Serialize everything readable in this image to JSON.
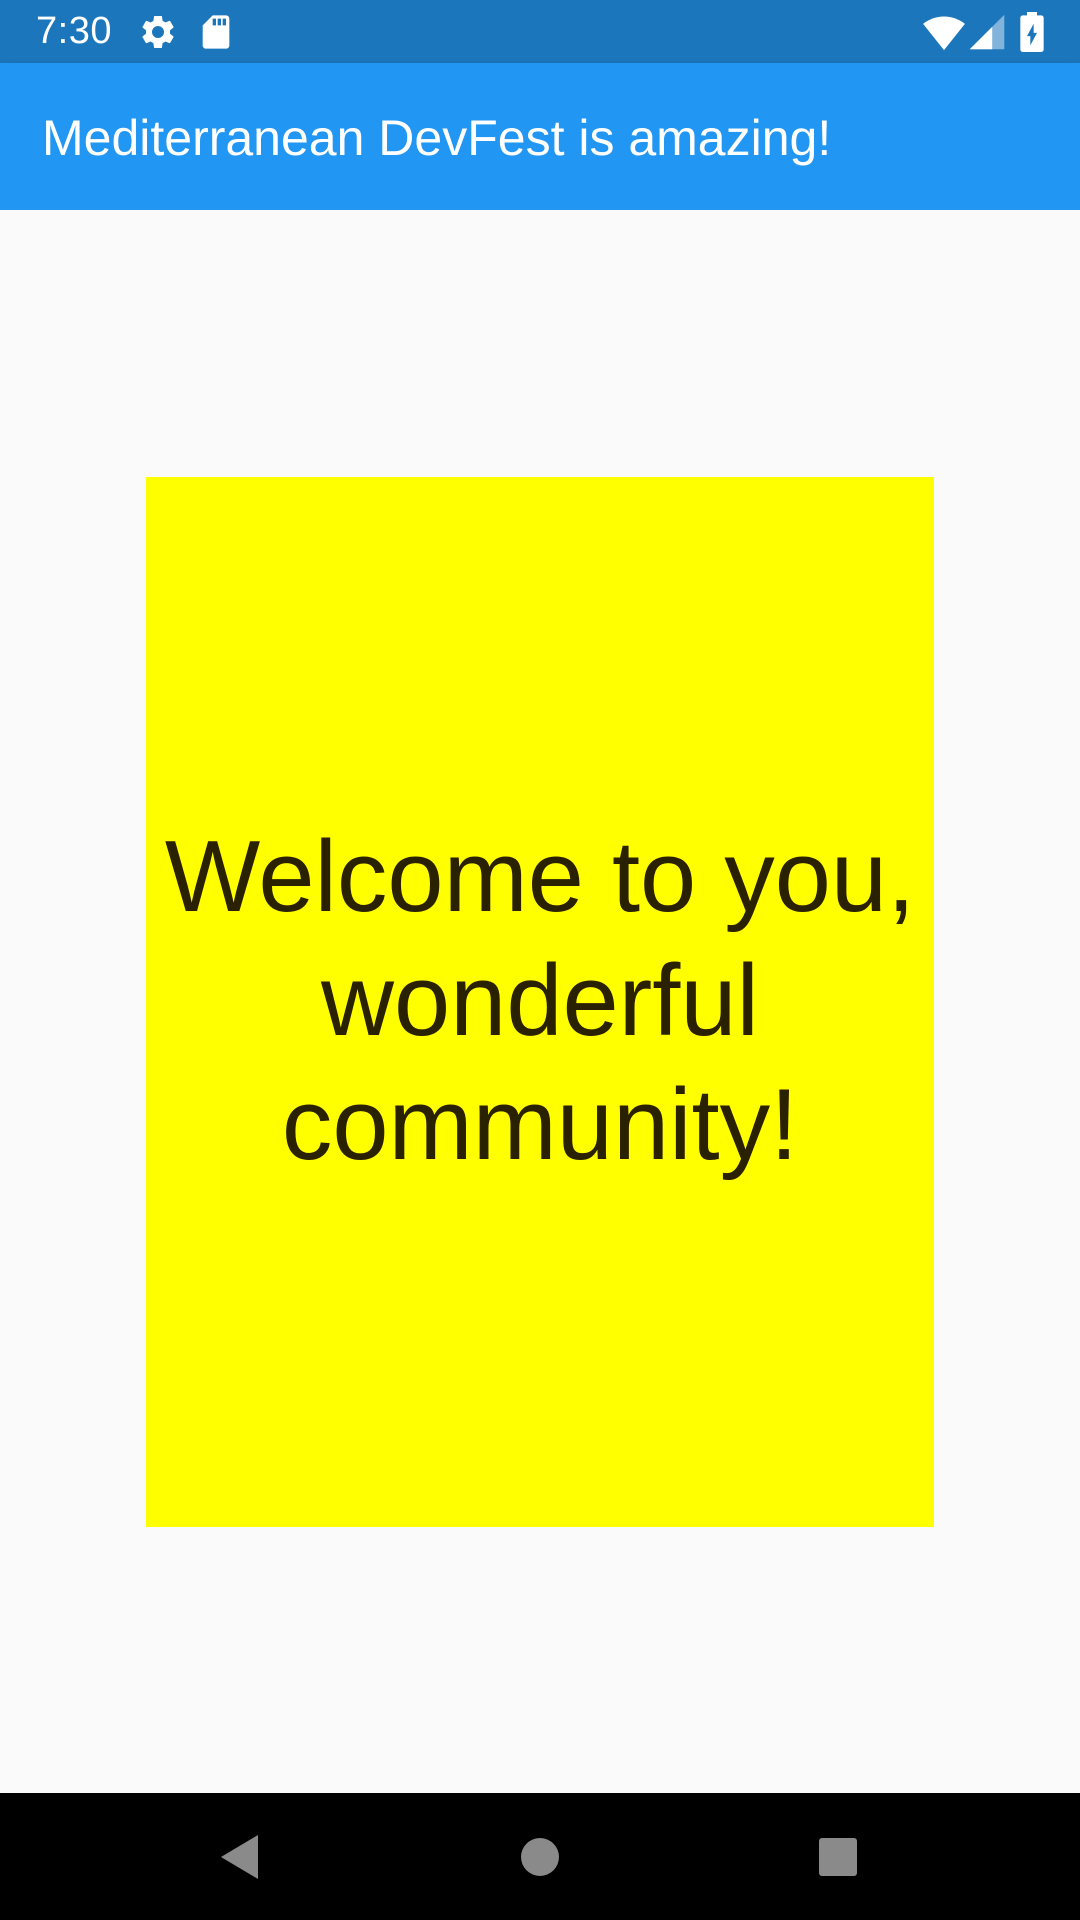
{
  "status_bar": {
    "time": "7:30",
    "icons": [
      "settings-icon",
      "sd-card-icon",
      "wifi-icon",
      "signal-icon",
      "battery-charging-icon"
    ],
    "background_color": "#1c76bc"
  },
  "app_bar": {
    "title": "Mediterranean DevFest is amazing!",
    "background_color": "#2196f3"
  },
  "main": {
    "message_line_1": "Welcome to you,",
    "message_line_2": "wonderful",
    "message_line_3": "community!",
    "box_color": "#ffff00",
    "text_color": "#2a2100"
  },
  "nav_bar": {
    "buttons": [
      "back-icon",
      "home-icon",
      "recents-icon"
    ]
  }
}
